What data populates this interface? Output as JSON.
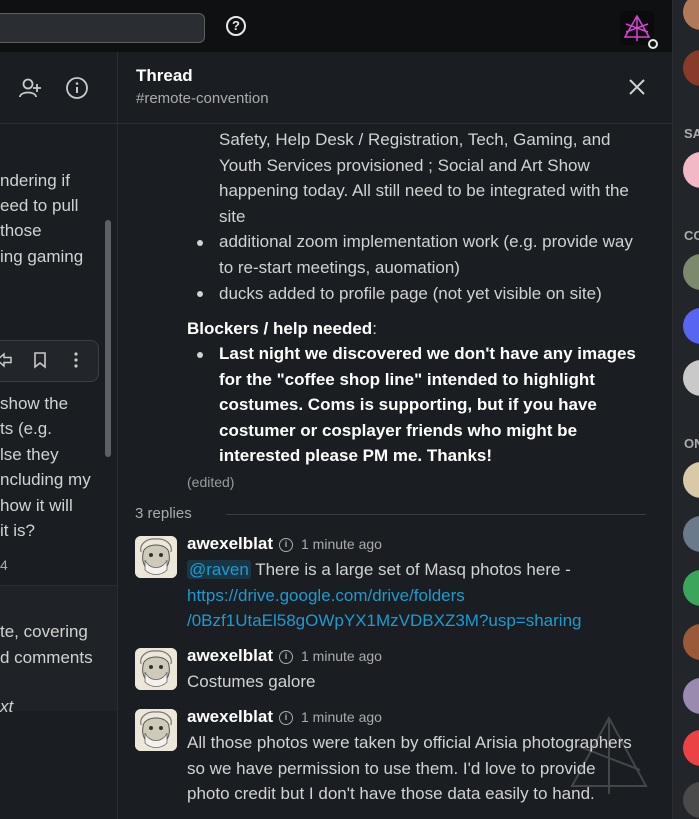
{
  "topbar": {
    "help_icon": "help-circle-icon",
    "search_value": ""
  },
  "left": {
    "lines_top": [
      "ndering if",
      "eed to pull",
      "those",
      "ing gaming"
    ],
    "lines_mid": [
      "show the",
      "ts (e.g.",
      "lse they",
      "ncluding my",
      "how it will",
      " it is?"
    ],
    "count": "4",
    "lines_bottom": [
      "te, covering",
      "d comments"
    ],
    "italic_line": "xt"
  },
  "thread": {
    "title": "Thread",
    "channel": "#remote-convention",
    "para_lines": [
      "Safety, Help Desk / Registration, Tech, Gaming, and",
      "Youth Services provisioned ; Social and Art Show",
      "happening today. All still need to be integrated with the",
      "site"
    ],
    "bullets": [
      [
        "additional zoom implementation work (e.g. provide way",
        "to re-start meetings, auomation)"
      ],
      [
        "ducks added to profile page (not yet visible on site)"
      ]
    ],
    "blockers_heading": "Blockers / help needed",
    "blockers_colon": ":",
    "blocker_lines": [
      "Last night we discovered we don't have any images",
      "for the \"coffee shop line\" intended to highlight",
      "costumes. Coms is supporting, but if you have",
      "costumer or cosplayer friends who might be",
      "interested please PM me. Thanks!"
    ],
    "edited": "(edited)",
    "reply_count": "3 replies"
  },
  "replies": [
    {
      "author": "awexelblat",
      "time": "1 minute ago",
      "mention": "@raven",
      "text_after_mention": " There is a large set of Masq photos here -",
      "link_line1": "https://drive.google.com/drive/folders",
      "link_line2": "/0Bzf1UtaEl58gOWpYX1MzVDBXZ3M?usp=sharing"
    },
    {
      "author": "awexelblat",
      "time": "1 minute ago",
      "text": "Costumes galore"
    },
    {
      "author": "awexelblat",
      "time": "1 minute ago",
      "lines": [
        "All those photos were taken by official Arisia photographers",
        "so we have permission to use them. I'd love to provide",
        "photo credit but I don't have those data easily to hand."
      ]
    }
  ],
  "right": {
    "sections": [
      "SA",
      "CO",
      "ON"
    ]
  },
  "colors": {
    "link": "#1d9bd1",
    "background": "#1a1d21",
    "logo_accent": "#d845d8"
  }
}
